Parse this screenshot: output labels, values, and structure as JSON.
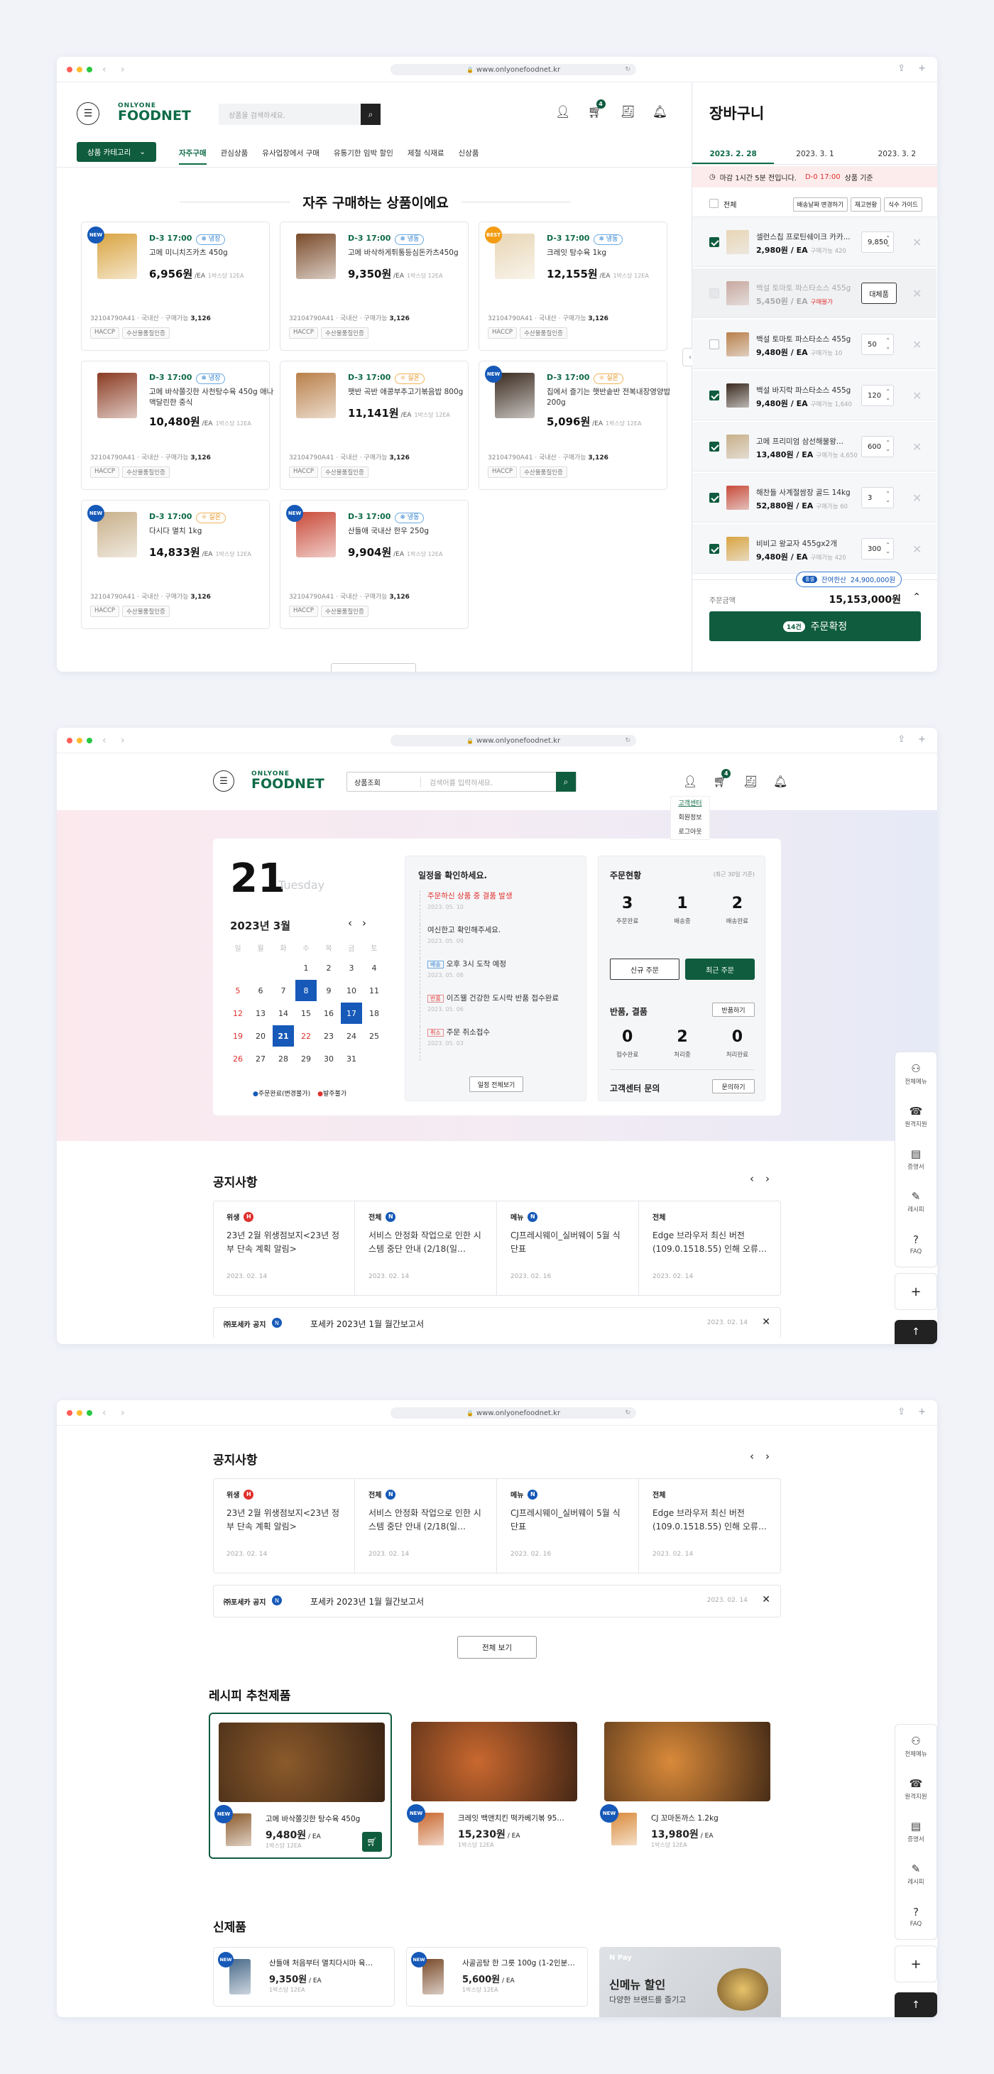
{
  "browser": {
    "url": "www.onlyonefoodnet.kr"
  },
  "colors": {
    "brand": "#0f5c3e",
    "accent_blue": "#1659b8",
    "alert_red": "#e0302c"
  },
  "brand": {
    "logo_top": "ONLYONE",
    "logo_bottom": "FOODNET"
  },
  "s1": {
    "search_placeholder": "상품을 검색하세요.",
    "cart_count": "4",
    "category_button": "상품 카테고리",
    "tabs": [
      "자주구매",
      "관심상품",
      "유사업장에서 구매",
      "유통기한 임박 할인",
      "제철 식재료",
      "신상품"
    ],
    "heading": "자주 구매하는 상품이에요",
    "products": [
      {
        "badge": "NEW",
        "dday": "D-3  17:00",
        "tag": "냉장",
        "name": "고메 미니치즈카츠 450g",
        "price": "6,956원",
        "unit": "/EA",
        "sub": "1박스당 12EA",
        "code": "32104790A41",
        "origin": "국내산",
        "buy": "3,126",
        "chips": [
          "HACCP",
          "수산물품질인증"
        ]
      },
      {
        "badge": "",
        "dday": "D-3  17:00",
        "tag": "냉동",
        "name": "고메 바삭하게튀통등심돈카츠450g",
        "price": "9,350원",
        "unit": "/EA",
        "sub": "1박스당 12EA",
        "code": "32104790A41",
        "origin": "국내산",
        "buy": "3,126",
        "chips": [
          "HACCP",
          "수산물품질인증"
        ]
      },
      {
        "badge": "BEST",
        "dday": "D-3  17:00",
        "tag": "냉동",
        "name": "크레잇 탕수육 1kg",
        "price": "12,155원",
        "unit": "/EA",
        "sub": "1박스당 12EA",
        "code": "32104790A41",
        "origin": "국내산",
        "buy": "3,126",
        "chips": [
          "HACCP",
          "수산물품질인증"
        ]
      },
      {
        "badge": "",
        "dday": "D-3  17:00",
        "tag": "냉장",
        "name": "고메 바삭쫄깃한 사천탕수육 450g 애나 맥달린한 중식",
        "price": "10,480원",
        "unit": "/EA",
        "sub": "1박스당 12EA",
        "code": "32104790A41",
        "origin": "국내산",
        "buy": "3,126",
        "chips": [
          "HACCP",
          "수산물품질인증"
        ]
      },
      {
        "badge": "",
        "dday": "D-3  17:00",
        "tag": "실온",
        "name": "햇반 곡반 애콩부추고기볶음밥 800g",
        "price": "11,141원",
        "unit": "/EA",
        "sub": "1박스당 12EA",
        "code": "32104790A41",
        "origin": "국내산",
        "buy": "3,126",
        "chips": [
          "HACCP",
          "수산물품질인증"
        ]
      },
      {
        "badge": "NEW",
        "dday": "D-3  17:00",
        "tag": "실온",
        "name": "집에서 즐기는 햇반솥반 전복내장영양밥 200g",
        "price": "5,096원",
        "unit": "/EA",
        "sub": "1박스당 12EA",
        "code": "32104790A41",
        "origin": "국내산",
        "buy": "3,126",
        "chips": [
          "HACCP",
          "수산물품질인증"
        ]
      },
      {
        "badge": "NEW",
        "dday": "D-3  17:00",
        "tag": "실온",
        "name": "다시다 멸치 1kg",
        "price": "14,833원",
        "unit": "/EA",
        "sub": "1박스당 12EA",
        "code": "32104790A41",
        "origin": "국내산",
        "buy": "3,126",
        "chips": [
          "HACCP",
          "수산물품질인증"
        ]
      },
      {
        "badge": "NEW",
        "dday": "D-3  17:00",
        "tag": "냉동",
        "name": "산들애 국내산 한우 250g",
        "price": "9,904원",
        "unit": "/EA",
        "sub": "1박스당 12EA",
        "code": "32104790A41",
        "origin": "국내산",
        "buy": "3,126",
        "chips": [
          "HACCP",
          "수산물품질인증"
        ]
      }
    ],
    "meta_labels": {
      "origin_sep": "·",
      "buy_label": "구매가능"
    },
    "cart": {
      "title": "장바구니",
      "dates": [
        "2023. 2. 28",
        "2023. 3. 1",
        "2023. 3. 2"
      ],
      "deadline_a": "마감 1시간 5분 전입니다.",
      "deadline_b": "D-0  17:00",
      "deadline_c": "상품 기준",
      "all": "전체",
      "actions": [
        "배송날짜 변경하기",
        "재고현황",
        "식수 가이드"
      ],
      "items": [
        {
          "name": "셀런스칩 프로틴쉐이크 카카...",
          "price": "2,980원",
          "unit": "/ EA",
          "note": "구매가능 420",
          "qty": "9,850",
          "checked": true
        },
        {
          "name": "백설 토마토 파스타소스 455g",
          "price": "5,450원",
          "unit": "/ EA",
          "note": "구매불가",
          "qty": "대체품",
          "checked": false,
          "disabled": true
        },
        {
          "name": "백설 토마토 파스타소스 455g",
          "price": "9,480원",
          "unit": "/ EA",
          "note": "구매가능 10",
          "qty": "50",
          "checked": false
        },
        {
          "name": "백설 바지락 파스타소스 455g",
          "price": "9,480원",
          "unit": "/ EA",
          "note": "구매가능 1,640",
          "qty": "120",
          "checked": true
        },
        {
          "name": "고메 프리미엄 삼선해물왕...",
          "price": "13,480원",
          "unit": "/ EA",
          "note": "구매가능 4,650",
          "qty": "600",
          "checked": true
        },
        {
          "name": "해찬들 사계절쌈장 골드 14kg",
          "price": "52,880원",
          "unit": "/ EA",
          "note": "구매가능 60",
          "qty": "3",
          "checked": true
        },
        {
          "name": "비비고 왕교자 455gx2개",
          "price": "9,480원",
          "unit": "/ EA",
          "note": "구매가능 420",
          "qty": "300",
          "checked": true
        }
      ],
      "remain_tag": "홀셀",
      "remain_label": "잔여한산",
      "remain_value": "24,900,000원",
      "total_label": "주문금액",
      "total": "15,153,000원",
      "order_count": "14건",
      "order_button": "주문확정"
    }
  },
  "s2": {
    "search_select": "상품조회",
    "search_placeholder": "검색어를 입력하세요.",
    "cart_count": "4",
    "dropdown": [
      "고객센터",
      "회원정보",
      "로그아웃"
    ],
    "day": "21",
    "weekday": "Tuesday",
    "month": "2023년 3월",
    "weekdays": [
      "일",
      "월",
      "화",
      "수",
      "목",
      "금",
      "토"
    ],
    "weeks": [
      [
        "",
        "",
        "",
        "1",
        "2",
        "3",
        "4"
      ],
      [
        "5",
        "6",
        "7",
        "8",
        "9",
        "10",
        "11"
      ],
      [
        "12",
        "13",
        "14",
        "15",
        "16",
        "17",
        "18"
      ],
      [
        "19",
        "20",
        "21",
        "22",
        "23",
        "24",
        "25"
      ],
      [
        "26",
        "27",
        "28",
        "29",
        "30",
        "31",
        ""
      ]
    ],
    "legend": [
      "주문완료(변경불가)",
      "발주불가"
    ],
    "schedule_title": "일정을 확인하세요.",
    "schedule": [
      {
        "tag": "",
        "text": "주문하신 상품 중 결품 발생",
        "date": "2023. 05. 10",
        "red": true
      },
      {
        "tag": "",
        "text": "여신한고 확인해주세요.",
        "date": "2023. 05. 09",
        "red": false
      },
      {
        "tag": "배송",
        "text": "오후 3시 도착 예정",
        "date": "2023. 05. 08",
        "red": false
      },
      {
        "tag": "반품",
        "text": "이즈웰 건강한 도시락 반품 접수완료",
        "date": "2023. 05. 06",
        "red": false
      },
      {
        "tag": "취소",
        "text": "주문 취소접수",
        "date": "2023. 05. 03",
        "red": false
      }
    ],
    "schedule_button": "일정 전체보기",
    "order_title": "주문현황",
    "order_period": "(최근 30일 기준)",
    "order_stats": [
      {
        "n": "3",
        "l": "주문완료"
      },
      {
        "n": "1",
        "l": "배송중"
      },
      {
        "n": "2",
        "l": "배송완료"
      }
    ],
    "new_order": "신규 주문",
    "recent_order": "최근 주문",
    "return_title": "반품, 결품",
    "return_button": "반품하기",
    "return_stats": [
      {
        "n": "0",
        "l": "접수완료"
      },
      {
        "n": "2",
        "l": "처리중"
      },
      {
        "n": "0",
        "l": "처리완료"
      }
    ],
    "cs_title": "고객센터 문의",
    "cs_button": "문의하기"
  },
  "notices": {
    "title": "공지사항",
    "items": [
      {
        "cat": "위생",
        "badge": "H",
        "color": "#e0302c",
        "text": "23년 2월 위생점보지<23년 정부 단속 계획 알림>",
        "date": "2023. 02. 14"
      },
      {
        "cat": "전체",
        "badge": "N",
        "color": "#1659b8",
        "text": "서비스 안정화 작업으로 인한 시스템 중단 안내 (2/18(일…",
        "date": "2023. 02. 14"
      },
      {
        "cat": "메뉴",
        "badge": "N",
        "color": "#1659b8",
        "text": "CJ프레시웨이_실버웨이 5월 식단표",
        "date": "2023. 02. 16"
      },
      {
        "cat": "전체",
        "badge": "",
        "color": "#1659b8",
        "text": "Edge 브라우저 최신 버전 (109.0.1518.55) 인해 오류…",
        "date": "2023. 02. 14"
      }
    ],
    "bar_label": "㈜포세카 공지",
    "bar_badge": "N",
    "bar_text": "포세카 2023년 1월 월간보고서",
    "bar_date": "2023. 02. 14",
    "more": "전체 보기"
  },
  "side_menu": [
    {
      "icon": "menu-icon",
      "label": "전체메뉴"
    },
    {
      "icon": "support-icon",
      "label": "원격지원"
    },
    {
      "icon": "certificate-icon",
      "label": "증명서"
    },
    {
      "icon": "recipe-icon",
      "label": "레시피"
    },
    {
      "icon": "faq-icon",
      "label": "FAQ"
    }
  ],
  "s3": {
    "recipe_title": "레시피 추천제품",
    "recipes": [
      {
        "name": "고메 바삭쫄깃한 탕수육 450g",
        "price": "9,480원",
        "unit": "/ EA",
        "sub": "1박스당 12EA"
      },
      {
        "name": "크레잇 백앤치킨 떡카베기볶 95…",
        "price": "15,230원",
        "unit": "/ EA",
        "sub": "1박스당 12EA"
      },
      {
        "name": "CJ 꼬마돈까스 1.2kg",
        "price": "13,980원",
        "unit": "/ EA",
        "sub": "1박스당 12EA"
      }
    ],
    "new_title": "신제품",
    "new_products": [
      {
        "name": "산들애 처음부터 멸치다시마 육…",
        "price": "9,350원",
        "unit": "/ EA",
        "sub": "1박스당 12EA"
      },
      {
        "name": "사골곰탕 한 그릇 100g (1-2인분…",
        "price": "5,600원",
        "unit": "/ EA",
        "sub": "1박스당 12EA"
      }
    ],
    "promo_brand": "N Pay",
    "promo_title": "신메뉴 할인",
    "promo_sub": "다양한 브랜드를 즐기고"
  }
}
